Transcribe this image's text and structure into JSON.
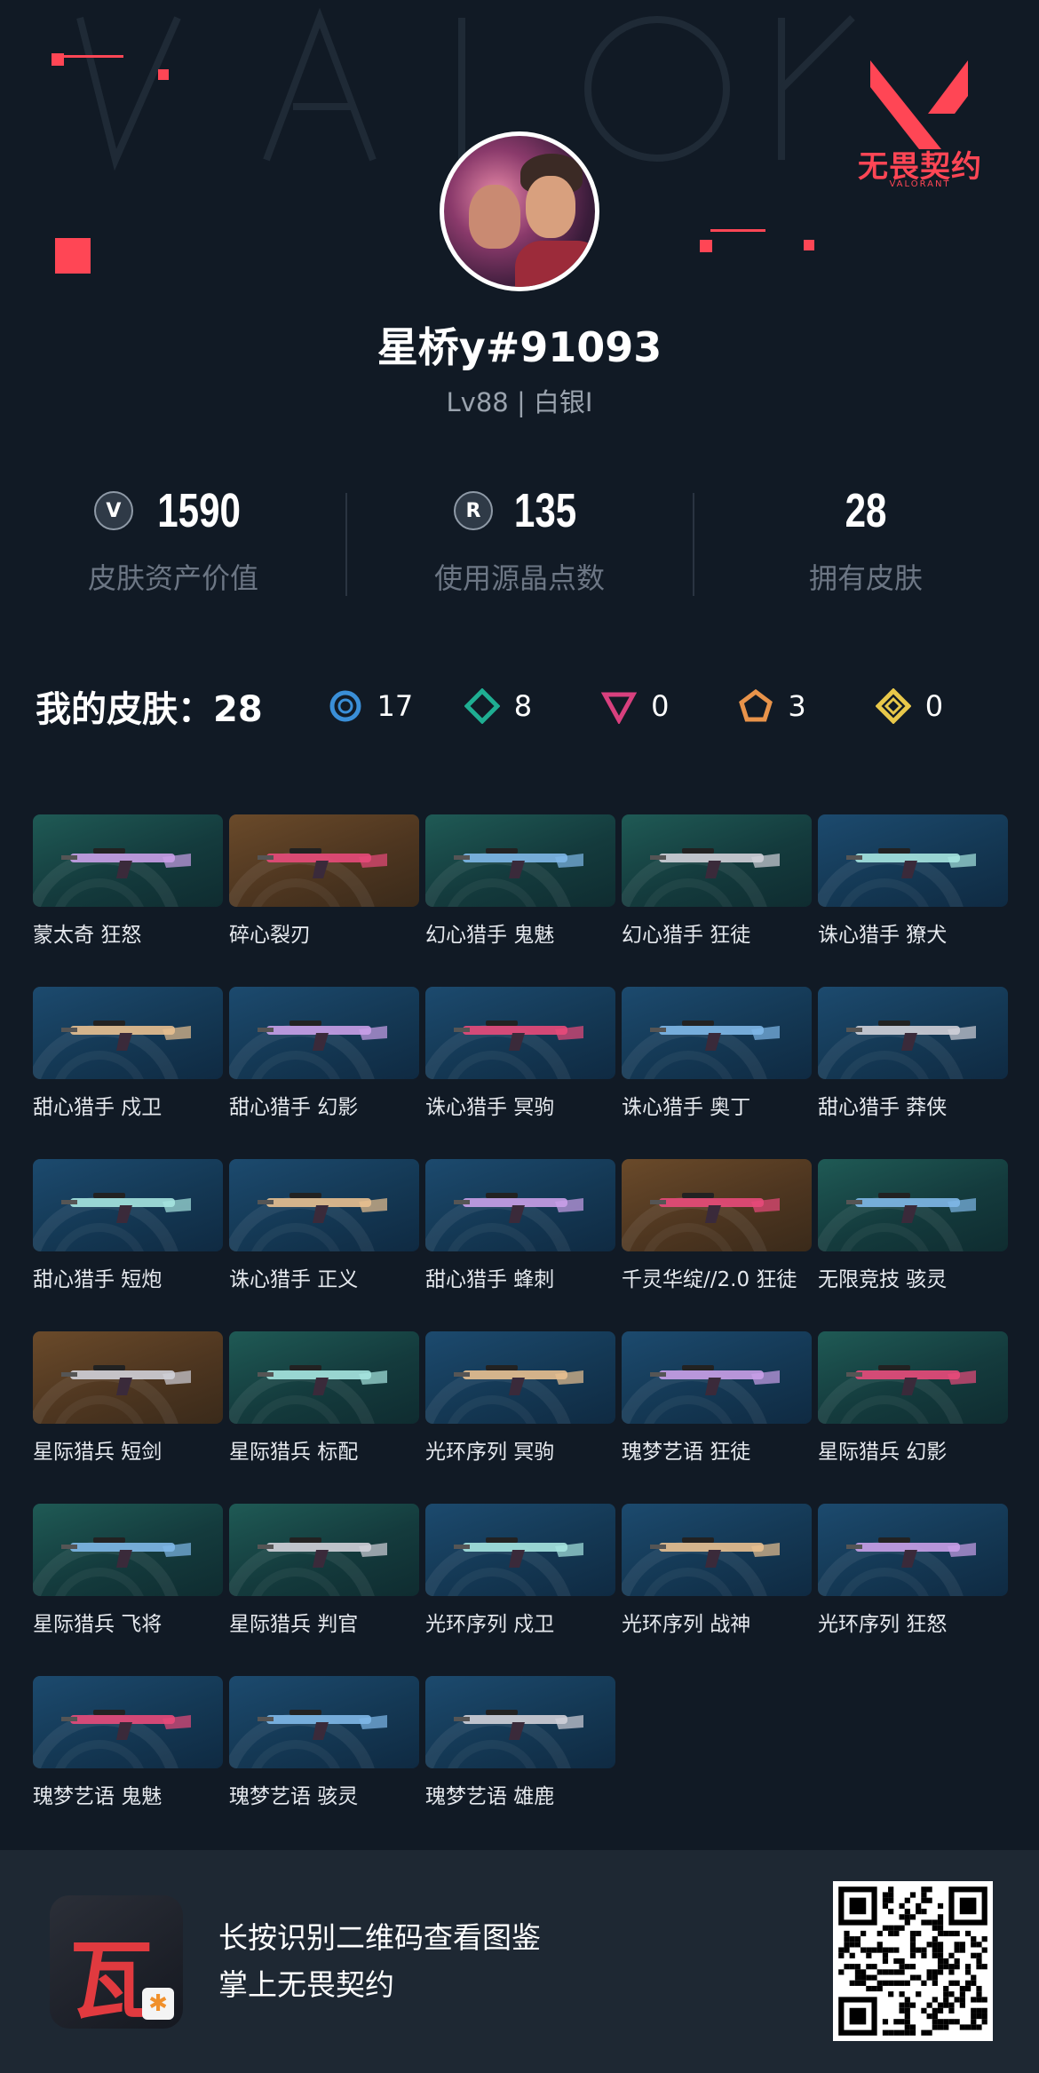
{
  "brand": {
    "name": "无畏契约",
    "sub": "VALORANT",
    "accent": "#ff4655"
  },
  "profile": {
    "name": "星桥y#91093",
    "level": "Lv88 | 白银I"
  },
  "stats": [
    {
      "icon": "valorant-points-icon",
      "value": "1590",
      "label": "皮肤资产价值"
    },
    {
      "icon": "radianite-icon",
      "value": "135",
      "label": "使用源晶点数"
    },
    {
      "icon": "",
      "value": "28",
      "label": "拥有皮肤"
    }
  ],
  "rarity": {
    "title": "我的皮肤：28",
    "items": [
      {
        "icon": "select-tier-icon",
        "color": "#3a8fd8",
        "count": "17"
      },
      {
        "icon": "deluxe-tier-icon",
        "color": "#1fae92",
        "count": "8"
      },
      {
        "icon": "premium-tier-icon",
        "color": "#d8407e",
        "count": "0"
      },
      {
        "icon": "ultra-tier-icon",
        "color": "#e8934a",
        "count": "3"
      },
      {
        "icon": "exclusive-tier-icon",
        "color": "#e8c84a",
        "count": "0"
      }
    ]
  },
  "skins": [
    {
      "name": "蒙太奇 狂怒",
      "bg": "green"
    },
    {
      "name": "碎心裂刃",
      "bg": "gold"
    },
    {
      "name": "幻心猎手 鬼魅",
      "bg": "green"
    },
    {
      "name": "幻心猎手 狂徒",
      "bg": "green"
    },
    {
      "name": "诛心猎手 獠犬",
      "bg": "blue"
    },
    {
      "name": "甜心猎手 戍卫",
      "bg": "blue"
    },
    {
      "name": "甜心猎手 幻影",
      "bg": "blue"
    },
    {
      "name": "诛心猎手 冥驹",
      "bg": "blue"
    },
    {
      "name": "诛心猎手 奥丁",
      "bg": "blue"
    },
    {
      "name": "甜心猎手 莽侠",
      "bg": "blue"
    },
    {
      "name": "甜心猎手 短炮",
      "bg": "blue"
    },
    {
      "name": "诛心猎手 正义",
      "bg": "blue"
    },
    {
      "name": "甜心猎手 蜂刺",
      "bg": "blue"
    },
    {
      "name": "千灵华绽//2.0 狂徒",
      "bg": "gold"
    },
    {
      "name": "无限竞技 骇灵",
      "bg": "green"
    },
    {
      "name": "星际猎兵 短剑",
      "bg": "gold"
    },
    {
      "name": "星际猎兵 标配",
      "bg": "green"
    },
    {
      "name": "光环序列 冥驹",
      "bg": "blue"
    },
    {
      "name": "瑰梦艺语 狂徒",
      "bg": "blue"
    },
    {
      "name": "星际猎兵 幻影",
      "bg": "green"
    },
    {
      "name": "星际猎兵 飞将",
      "bg": "green"
    },
    {
      "name": "星际猎兵 判官",
      "bg": "green"
    },
    {
      "name": "光环序列 戍卫",
      "bg": "blue"
    },
    {
      "name": "光环序列 战神",
      "bg": "blue"
    },
    {
      "name": "光环序列 狂怒",
      "bg": "blue"
    },
    {
      "name": "瑰梦艺语 鬼魅",
      "bg": "blue"
    },
    {
      "name": "瑰梦艺语 骇灵",
      "bg": "blue"
    },
    {
      "name": "瑰梦艺语 雄鹿",
      "bg": "blue"
    }
  ],
  "footer": {
    "line1": "长按识别二维码查看图鉴",
    "line2": "掌上无畏契约",
    "app_icon_glyph": "瓦"
  }
}
